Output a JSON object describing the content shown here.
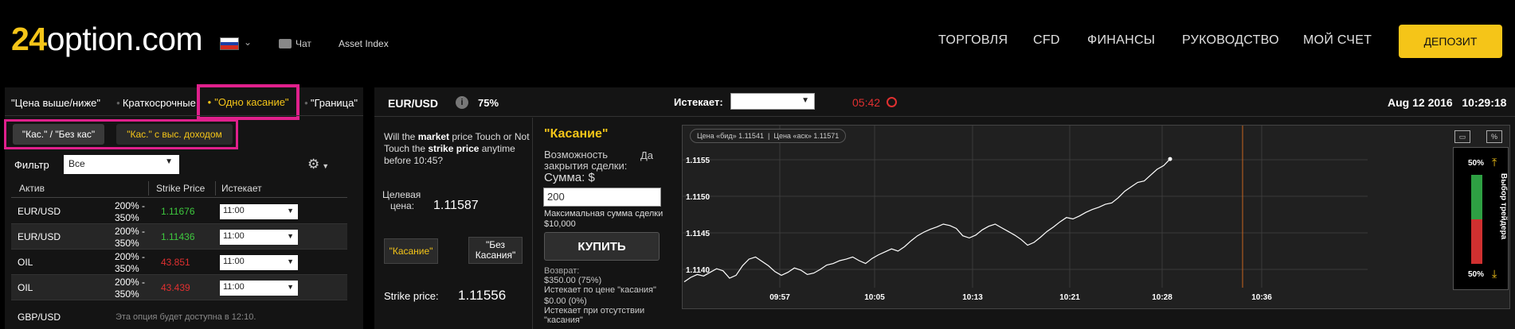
{
  "header": {
    "logo_prefix": "24",
    "logo_suffix": "option.com",
    "chat_label": "Чат",
    "asset_index_label": "Asset Index",
    "nav": [
      "ТОРГОВЛЯ",
      "CFD",
      "ФИНАНСЫ",
      "РУКОВОДСТВО",
      "МОЙ СЧЕТ"
    ],
    "deposit_label": "ДЕПОЗИТ"
  },
  "option_tabs": [
    "\"Цена выше/ниже\"",
    "Краткосрочные",
    "\"Одно касание\"",
    "\"Граница\""
  ],
  "sub_tabs": [
    "\"Кас.\" / \"Без кас\"",
    "\"Кас.\" с выс. доходом"
  ],
  "filter": {
    "label": "Фильтр",
    "value": "Все"
  },
  "table": {
    "headers": [
      "Актив",
      "Strike Price",
      "Истекает"
    ],
    "rows": [
      {
        "asset": "EUR/USD",
        "payout_a": "200% -",
        "payout_b": "350%",
        "strike": "1.11676",
        "strike_color": "#3ec93e",
        "expires": "11:00"
      },
      {
        "asset": "EUR/USD",
        "payout_a": "200% -",
        "payout_b": "350%",
        "strike": "1.11436",
        "strike_color": "#3ec93e",
        "expires": "11:00"
      },
      {
        "asset": "OIL",
        "payout_a": "200% -",
        "payout_b": "350%",
        "strike": "43.851",
        "strike_color": "#e03030",
        "expires": "11:00"
      },
      {
        "asset": "OIL",
        "payout_a": "200% -",
        "payout_b": "350%",
        "strike": "43.439",
        "strike_color": "#e03030",
        "expires": "11:00"
      },
      {
        "asset": "GBP/USD",
        "note": "Эта опция будет доступна в 12:10."
      }
    ]
  },
  "trade": {
    "pair": "EUR/USD",
    "payout": "75%",
    "expires_label": "Истекает:",
    "timer": "05:42",
    "date": "Aug 12 2016",
    "time": "10:29:18",
    "question_1": "Will the ",
    "question_market": "market",
    "question_2": " price Touch or Not Touch the ",
    "question_strike": "strike price",
    "question_3": " anytime before 10:45?",
    "target_label_1": "Целевая",
    "target_label_2": "цена:",
    "target_value": "1.11587",
    "touch_btn": "\"Касание\"",
    "notouch_btn_1": "\"Без",
    "notouch_btn_2": "Касания\"",
    "strike_label": "Strike price:",
    "strike_value": "1.11556",
    "touch_title": "\"Касание\"",
    "possibility_1": "Возможность",
    "possibility_2": "закрытия сделки:",
    "possibility_yes": "Да",
    "amount_label": "Сумма:  $",
    "amount_value": "200",
    "max_sum_1": "Максимальная сумма сделки",
    "max_sum_2": "$10,000",
    "buy_label": "КУПИТЬ",
    "return_label": "Возврат:",
    "return_touch_value": "$350.00 (75%)",
    "return_touch_text": "Истекает по цене \"касания\"",
    "return_notouch_value": "$0.00 (0%)",
    "return_notouch_text_1": "Истекает при отсутствии",
    "return_notouch_text_2": "\"касания\""
  },
  "chart_legend": {
    "bid": "Цена «бид» 1.11541",
    "ask": "Цена «аск» 1.11571"
  },
  "side_widget": {
    "top_pct": "50%",
    "bottom_pct": "50%",
    "label": "Выбор трейдера",
    "up_share": 0.5
  },
  "chart_data": {
    "type": "line",
    "x_ticks": [
      "09:57",
      "10:05",
      "10:13",
      "10:21",
      "10:28",
      "10:36"
    ],
    "y_ticks": [
      "1.1155",
      "1.1150",
      "1.1145",
      "1.1140"
    ],
    "ylim": [
      1.11375,
      1.11575
    ],
    "series": [
      {
        "values": [
          1.11383,
          1.11389,
          1.11393,
          1.11391,
          1.11396,
          1.11401,
          1.11398,
          1.11388,
          1.11392,
          1.11405,
          1.11414,
          1.11417,
          1.11411,
          1.11405,
          1.11397,
          1.11392,
          1.11396,
          1.11402,
          1.11399,
          1.11393,
          1.11395,
          1.114,
          1.11406,
          1.11408,
          1.11412,
          1.11414,
          1.11417,
          1.11412,
          1.11408,
          1.11415,
          1.1142,
          1.11424,
          1.11428,
          1.11425,
          1.11431,
          1.11439,
          1.11446,
          1.11451,
          1.11455,
          1.11458,
          1.11462,
          1.1146,
          1.11456,
          1.11446,
          1.11443,
          1.11447,
          1.11454,
          1.11459,
          1.11462,
          1.11457,
          1.11452,
          1.11447,
          1.11441,
          1.11433,
          1.11437,
          1.11444,
          1.11452,
          1.11458,
          1.11465,
          1.11471,
          1.11469,
          1.11473,
          1.11478,
          1.11482,
          1.11485,
          1.11489,
          1.11491,
          1.11498,
          1.11507,
          1.11513,
          1.11519,
          1.11521,
          1.11529,
          1.11537,
          1.11542,
          1.11551
        ]
      }
    ]
  }
}
